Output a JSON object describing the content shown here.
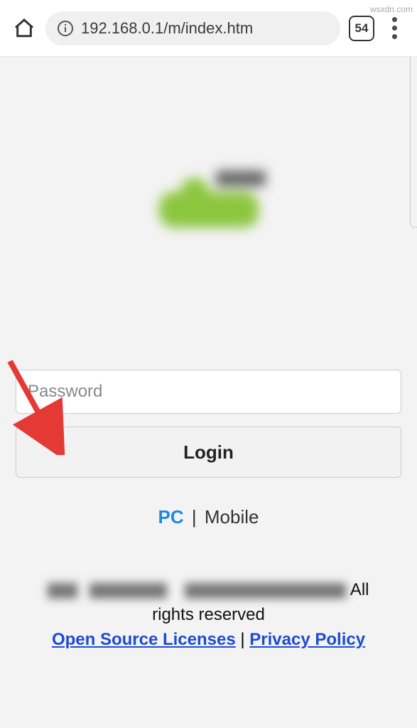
{
  "browser": {
    "url": "192.168.0.1/m/index.htm",
    "tab_count": "54"
  },
  "form": {
    "password_placeholder": "Password",
    "login_label": "Login"
  },
  "switch": {
    "pc": "PC",
    "separator": " | ",
    "mobile": "Mobile"
  },
  "footer": {
    "suffix_all": " All",
    "rights": "rights reserved",
    "open_source": "Open Source Licenses",
    "link_sep": "  |  ",
    "privacy": "Privacy Policy"
  },
  "watermark": "wsxdn.com",
  "icons": {
    "home": "home-icon",
    "info": "info-icon",
    "tabs": "tab-count-icon",
    "menu": "menu-dots-icon"
  }
}
